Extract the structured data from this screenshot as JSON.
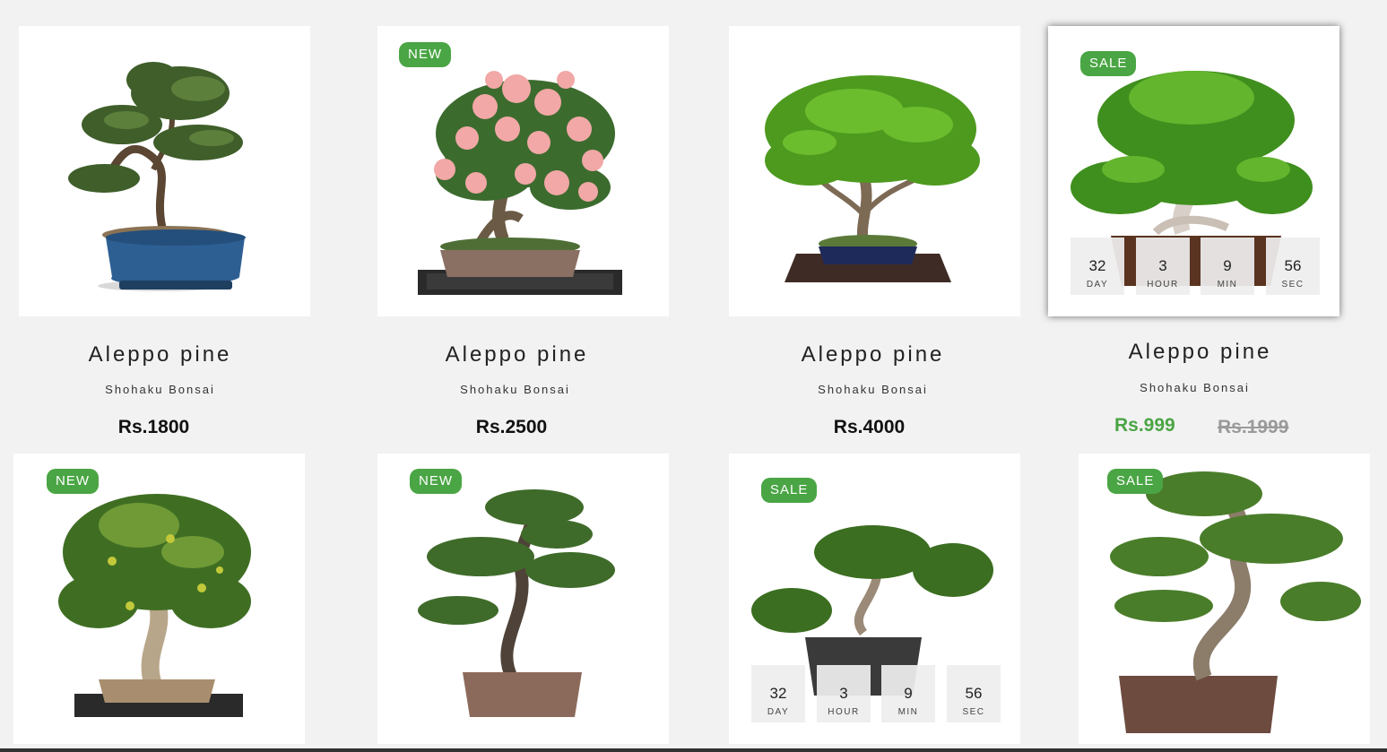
{
  "products": [
    {
      "title": "Aleppo pine",
      "brand": "Shohaku Bonsai",
      "price": "Rs.1800",
      "badge": "",
      "foliage": "pine",
      "pot": "blue"
    },
    {
      "title": "Aleppo pine",
      "brand": "Shohaku Bonsai",
      "price": "Rs.2500",
      "badge": "NEW",
      "foliage": "azalea",
      "pot": "brown-tray"
    },
    {
      "title": "Aleppo pine",
      "brand": "Shohaku Bonsai",
      "price": "Rs.4000",
      "badge": "",
      "foliage": "maple",
      "pot": "navy-tray"
    },
    {
      "title": "Aleppo pine",
      "brand": "Shohaku Bonsai",
      "sale_price": "Rs.999",
      "old_price": "Rs.1999",
      "badge": "SALE",
      "foliage": "juniper",
      "pot": "brown"
    },
    {
      "badge": "NEW",
      "foliage": "ficus",
      "pot": "stone-tray"
    },
    {
      "badge": "NEW",
      "foliage": "pine",
      "pot": "clay"
    },
    {
      "badge": "SALE",
      "foliage": "juniper",
      "pot": "dark"
    },
    {
      "badge": "SALE",
      "foliage": "juniper-tall",
      "pot": "rust"
    }
  ],
  "countdown": {
    "day": {
      "value": "32",
      "label": "DAY"
    },
    "hour": {
      "value": "3",
      "label": "HOUR"
    },
    "min": {
      "value": "9",
      "label": "MIN"
    },
    "sec": {
      "value": "56",
      "label": "SEC"
    }
  },
  "colors": {
    "accent": "#4aa544",
    "background": "#f2f2f2",
    "card": "#ffffff",
    "strike": "#9a9a9a"
  }
}
